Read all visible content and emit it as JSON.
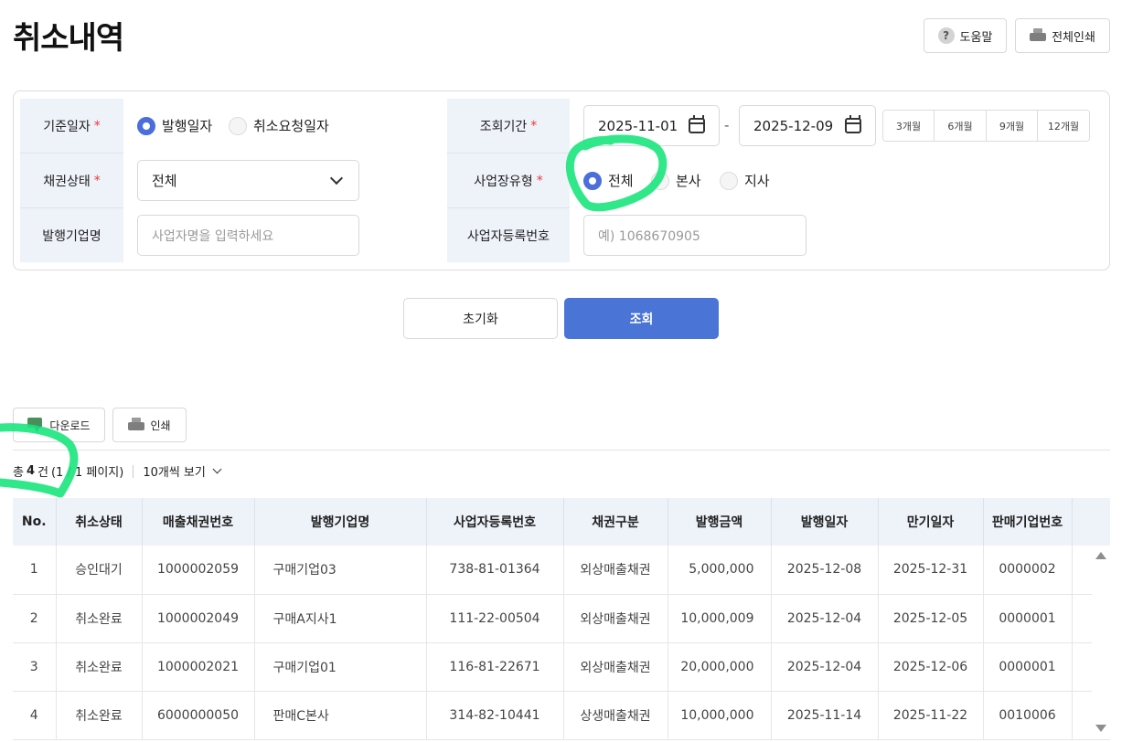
{
  "page": {
    "title": "취소내역"
  },
  "top_buttons": {
    "help": "도움말",
    "print_all": "전체인쇄"
  },
  "filters": {
    "base_date_label": "기준일자",
    "base_date_options": [
      "발행일자",
      "취소요청일자"
    ],
    "base_date_selected": "발행일자",
    "bond_status_label": "채권상태",
    "bond_status_value": "전체",
    "issuer_name_label": "발행기업명",
    "issuer_name_placeholder": "사업자명을 입력하세요",
    "period_label": "조회기간",
    "period_start": "2025-11-01",
    "period_end": "2025-12-09",
    "period_separator": "-",
    "period_quick": [
      "3개월",
      "6개월",
      "9개월",
      "12개월"
    ],
    "site_type_label": "사업장유형",
    "site_type_options": [
      "전체",
      "본사",
      "지사"
    ],
    "site_type_selected": "전체",
    "biz_reg_label": "사업자등록번호",
    "biz_reg_placeholder": "예) 1068670905",
    "required_mark": "*"
  },
  "actions": {
    "reset": "초기화",
    "search": "조회"
  },
  "list_toolbar": {
    "download": "다운로드",
    "print": "인쇄"
  },
  "summary": {
    "prefix": "총",
    "count": "4",
    "unit": "건",
    "pages": "(1 / 1 페이지)",
    "page_size": "10개씩 보기"
  },
  "table": {
    "headers": [
      "No.",
      "취소상태",
      "매출채권번호",
      "발행기업명",
      "사업자등록번호",
      "채권구분",
      "발행금액",
      "발행일자",
      "만기일자",
      "판매기업번호"
    ],
    "rows": [
      [
        "1",
        "승인대기",
        "1000002059",
        "구매기업03",
        "738-81-01364",
        "외상매출채권",
        "5,000,000",
        "2025-12-08",
        "2025-12-31",
        "0000002"
      ],
      [
        "2",
        "취소완료",
        "1000002049",
        "구매A지사1",
        "111-22-00504",
        "외상매출채권",
        "10,000,009",
        "2025-12-04",
        "2025-12-05",
        "0000001"
      ],
      [
        "3",
        "취소완료",
        "1000002021",
        "구매기업01",
        "116-81-22671",
        "외상매출채권",
        "20,000,000",
        "2025-12-04",
        "2025-12-06",
        "0000001"
      ],
      [
        "4",
        "취소완료",
        "6000000050",
        "판매C본사",
        "314-82-10441",
        "상생매출채권",
        "10,000,000",
        "2025-11-14",
        "2025-11-22",
        "0010006"
      ]
    ]
  },
  "colors": {
    "primary": "#4a74d6",
    "radio_on": "#4a6fdc",
    "label_bg": "#eef2f9",
    "required": "#e53935",
    "annotation": "#19e57c"
  },
  "icons": {
    "help": "question-circle-icon",
    "print": "printer-icon",
    "download": "excel-download-icon",
    "calendar": "calendar-icon",
    "dropdown": "chevron-down-icon"
  }
}
